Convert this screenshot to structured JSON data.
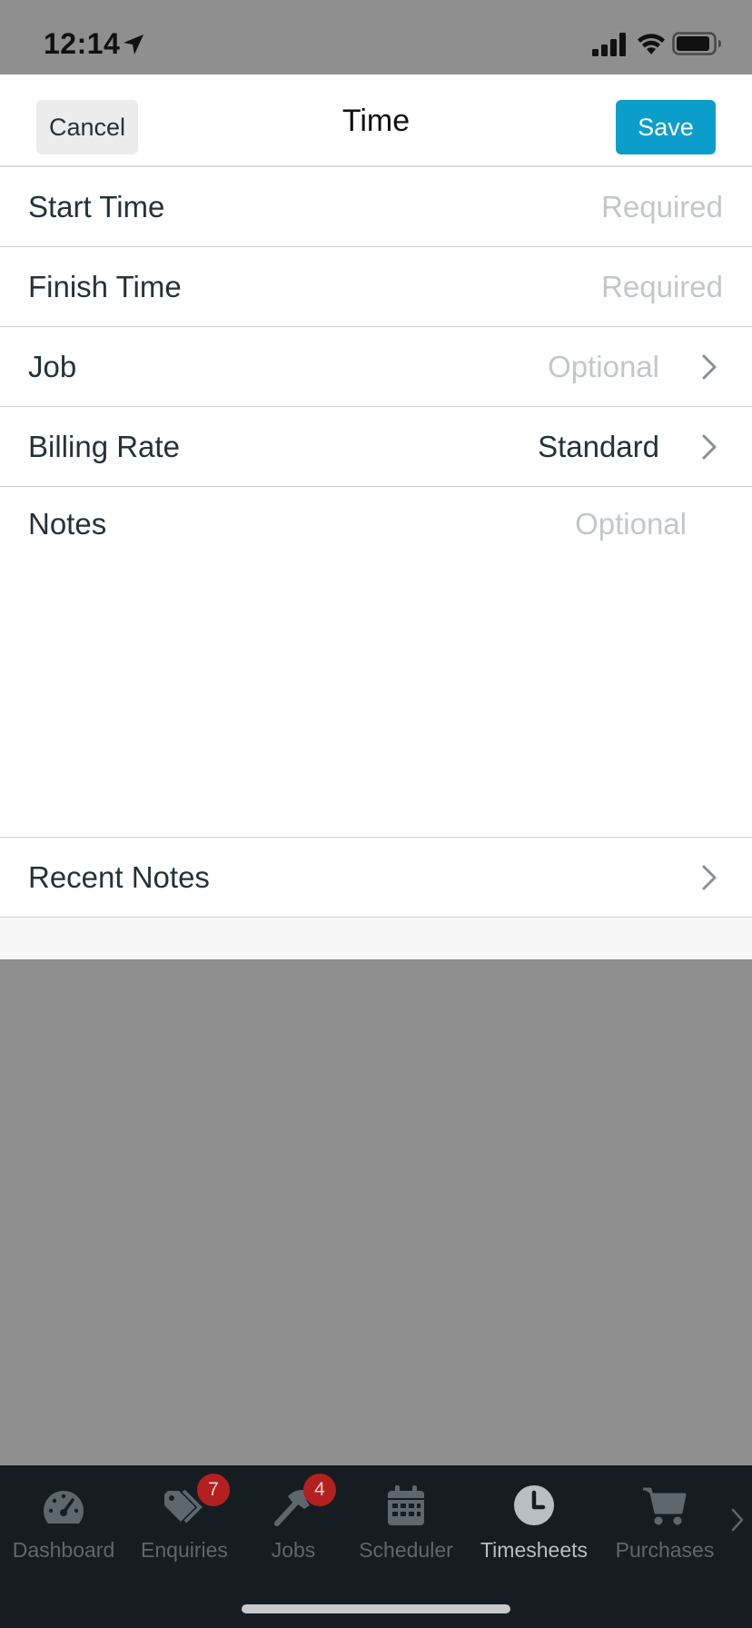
{
  "status_bar": {
    "time": "12:14"
  },
  "header": {
    "title": "Time",
    "cancel_label": "Cancel",
    "save_label": "Save"
  },
  "form": {
    "start_time": {
      "label": "Start Time",
      "placeholder": "Required"
    },
    "finish_time": {
      "label": "Finish Time",
      "placeholder": "Required"
    },
    "job": {
      "label": "Job",
      "placeholder": "Optional"
    },
    "billing_rate": {
      "label": "Billing Rate",
      "value": "Standard"
    },
    "notes": {
      "label": "Notes",
      "placeholder": "Optional"
    },
    "recent_notes": {
      "label": "Recent Notes"
    }
  },
  "tab_bar": {
    "active_tab": "Timesheets",
    "tabs": [
      {
        "label": "Dashboard",
        "icon": "speedometer-icon"
      },
      {
        "label": "Enquiries",
        "icon": "tags-icon",
        "badge": "7"
      },
      {
        "label": "Jobs",
        "icon": "hammer-icon",
        "badge": "4"
      },
      {
        "label": "Scheduler",
        "icon": "calendar-icon"
      },
      {
        "label": "Timesheets",
        "icon": "clock-icon"
      },
      {
        "label": "Purchases",
        "icon": "cart-icon"
      }
    ]
  },
  "colors": {
    "save_button": "#0c9ecb",
    "tab_bar_background": "#161d22",
    "badge": "#b3201f",
    "overlay": "#8f8f8f"
  }
}
